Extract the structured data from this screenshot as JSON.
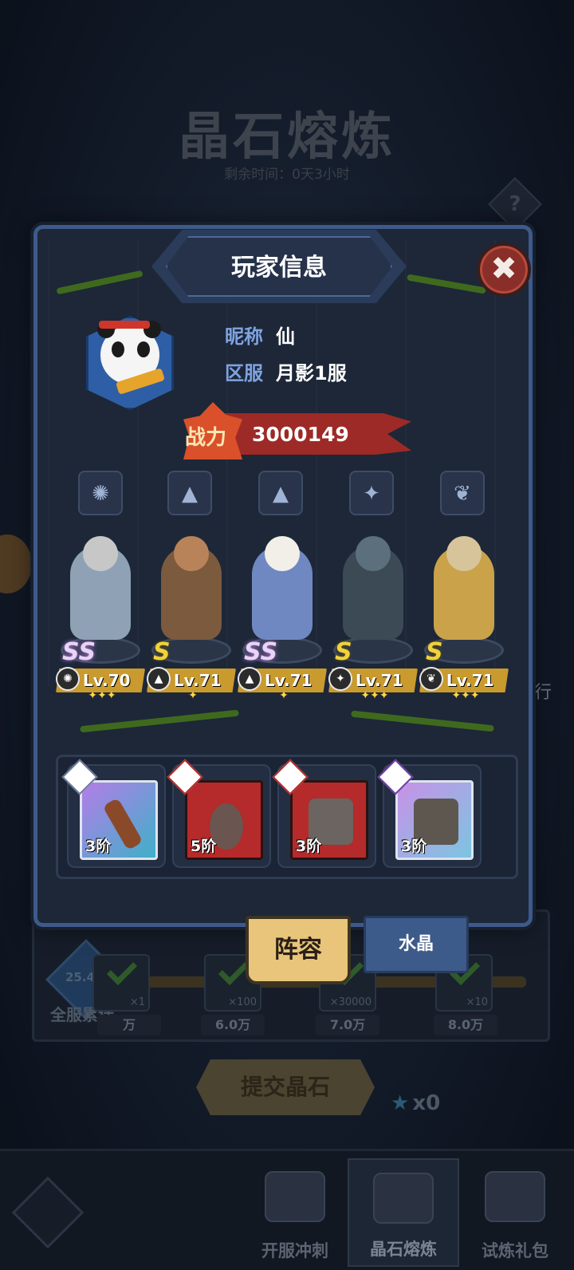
{
  "background": {
    "title": "晶石熔炼",
    "subtitle": "剩余时间：0天3小时",
    "help_label": "?",
    "side_label": "行",
    "total": {
      "value": "25.4万",
      "label": "全服累计"
    },
    "milestones": [
      {
        "qty": "×1",
        "label": "万"
      },
      {
        "qty": "×100",
        "label": "6.0万"
      },
      {
        "qty": "×30000",
        "label": "7.0万"
      },
      {
        "qty": "×10",
        "label": "8.0万"
      }
    ],
    "submit_label": "提交晶石",
    "star_count": "x0"
  },
  "bottom_nav": {
    "tabs": [
      {
        "label": "开服冲刺",
        "active": false
      },
      {
        "label": "晶石熔炼",
        "active": true
      },
      {
        "label": "试炼礼包",
        "active": false
      }
    ]
  },
  "modal": {
    "title": "玩家信息",
    "close_icon": "✖",
    "player": {
      "nickname_label": "昵称",
      "nickname": "仙",
      "server_label": "区服",
      "server": "月影1服",
      "avatar": "panda-avatar"
    },
    "power": {
      "label": "战力",
      "value": "3000149"
    },
    "class_icons": [
      {
        "icon": "monster-icon",
        "glyph": "✺"
      },
      {
        "icon": "mage-hat-icon",
        "glyph": "▲"
      },
      {
        "icon": "mage-hat-icon",
        "glyph": "▲"
      },
      {
        "icon": "wrench-icon",
        "glyph": "✦"
      },
      {
        "icon": "wing-icon",
        "glyph": "❦"
      }
    ],
    "heroes": [
      {
        "rank": "SS",
        "level": "Lv.70",
        "class_glyph": "✺",
        "stars": "✦✦✦",
        "color": "#8fa1b5",
        "head": "#c7c7c7"
      },
      {
        "rank": "S",
        "level": "Lv.71",
        "class_glyph": "▲",
        "stars": "✦",
        "color": "#7b5a3e",
        "head": "#b9835a"
      },
      {
        "rank": "SS",
        "level": "Lv.71",
        "class_glyph": "▲",
        "stars": "✦",
        "color": "#6f88c2",
        "head": "#f2efe8"
      },
      {
        "rank": "S",
        "level": "Lv.71",
        "class_glyph": "✦",
        "stars": "✦✦✦",
        "color": "#3b4a55",
        "head": "#5b6f7c"
      },
      {
        "rank": "S",
        "level": "Lv.71",
        "class_glyph": "❦",
        "stars": "✦✦✦",
        "color": "#c9a24a",
        "head": "#d8c49a"
      }
    ],
    "equipment": [
      {
        "tier": "3阶",
        "style": "purple",
        "item": "sword",
        "badge": "mage-hat-icon"
      },
      {
        "tier": "5阶",
        "style": "red",
        "item": "amulet",
        "badge": "mage-hat-icon"
      },
      {
        "tier": "3阶",
        "style": "red",
        "item": "armor-pants",
        "badge": "mage-hat-icon"
      },
      {
        "tier": "3阶",
        "style": "purple",
        "item": "armor-pants",
        "badge": "monster-icon"
      }
    ],
    "tabs": {
      "lineup": "阵容",
      "crystal": "水晶"
    }
  }
}
